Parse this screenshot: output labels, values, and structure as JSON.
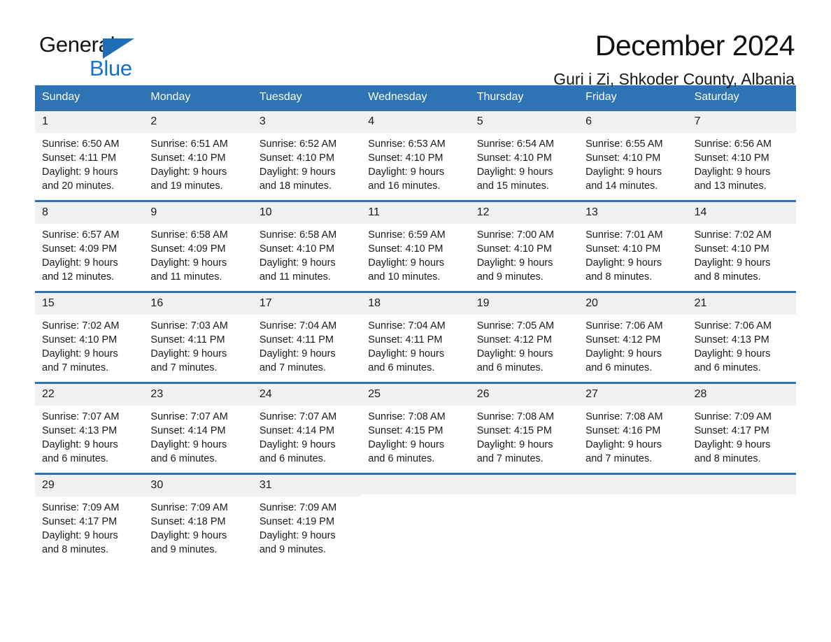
{
  "brand": {
    "name_dark": "General",
    "name_blue": "Blue",
    "accent_color": "#1771c4",
    "triangle_color": "#1f6eb5"
  },
  "header": {
    "title": "December 2024",
    "subtitle": "Guri i Zi, Shkoder County, Albania"
  },
  "table": {
    "header_bg": "#2e74b5",
    "header_text_color": "#ffffff",
    "daynum_bg": "#f1f1f1",
    "weekday_headers": [
      "Sunday",
      "Monday",
      "Tuesday",
      "Wednesday",
      "Thursday",
      "Friday",
      "Saturday"
    ]
  },
  "weeks": [
    [
      {
        "day": "1",
        "lines": [
          "Sunrise: 6:50 AM",
          "Sunset: 4:11 PM",
          "Daylight: 9 hours",
          "and 20 minutes."
        ]
      },
      {
        "day": "2",
        "lines": [
          "Sunrise: 6:51 AM",
          "Sunset: 4:10 PM",
          "Daylight: 9 hours",
          "and 19 minutes."
        ]
      },
      {
        "day": "3",
        "lines": [
          "Sunrise: 6:52 AM",
          "Sunset: 4:10 PM",
          "Daylight: 9 hours",
          "and 18 minutes."
        ]
      },
      {
        "day": "4",
        "lines": [
          "Sunrise: 6:53 AM",
          "Sunset: 4:10 PM",
          "Daylight: 9 hours",
          "and 16 minutes."
        ]
      },
      {
        "day": "5",
        "lines": [
          "Sunrise: 6:54 AM",
          "Sunset: 4:10 PM",
          "Daylight: 9 hours",
          "and 15 minutes."
        ]
      },
      {
        "day": "6",
        "lines": [
          "Sunrise: 6:55 AM",
          "Sunset: 4:10 PM",
          "Daylight: 9 hours",
          "and 14 minutes."
        ]
      },
      {
        "day": "7",
        "lines": [
          "Sunrise: 6:56 AM",
          "Sunset: 4:10 PM",
          "Daylight: 9 hours",
          "and 13 minutes."
        ]
      }
    ],
    [
      {
        "day": "8",
        "lines": [
          "Sunrise: 6:57 AM",
          "Sunset: 4:09 PM",
          "Daylight: 9 hours",
          "and 12 minutes."
        ]
      },
      {
        "day": "9",
        "lines": [
          "Sunrise: 6:58 AM",
          "Sunset: 4:09 PM",
          "Daylight: 9 hours",
          "and 11 minutes."
        ]
      },
      {
        "day": "10",
        "lines": [
          "Sunrise: 6:58 AM",
          "Sunset: 4:10 PM",
          "Daylight: 9 hours",
          "and 11 minutes."
        ]
      },
      {
        "day": "11",
        "lines": [
          "Sunrise: 6:59 AM",
          "Sunset: 4:10 PM",
          "Daylight: 9 hours",
          "and 10 minutes."
        ]
      },
      {
        "day": "12",
        "lines": [
          "Sunrise: 7:00 AM",
          "Sunset: 4:10 PM",
          "Daylight: 9 hours",
          "and 9 minutes."
        ]
      },
      {
        "day": "13",
        "lines": [
          "Sunrise: 7:01 AM",
          "Sunset: 4:10 PM",
          "Daylight: 9 hours",
          "and 8 minutes."
        ]
      },
      {
        "day": "14",
        "lines": [
          "Sunrise: 7:02 AM",
          "Sunset: 4:10 PM",
          "Daylight: 9 hours",
          "and 8 minutes."
        ]
      }
    ],
    [
      {
        "day": "15",
        "lines": [
          "Sunrise: 7:02 AM",
          "Sunset: 4:10 PM",
          "Daylight: 9 hours",
          "and 7 minutes."
        ]
      },
      {
        "day": "16",
        "lines": [
          "Sunrise: 7:03 AM",
          "Sunset: 4:11 PM",
          "Daylight: 9 hours",
          "and 7 minutes."
        ]
      },
      {
        "day": "17",
        "lines": [
          "Sunrise: 7:04 AM",
          "Sunset: 4:11 PM",
          "Daylight: 9 hours",
          "and 7 minutes."
        ]
      },
      {
        "day": "18",
        "lines": [
          "Sunrise: 7:04 AM",
          "Sunset: 4:11 PM",
          "Daylight: 9 hours",
          "and 6 minutes."
        ]
      },
      {
        "day": "19",
        "lines": [
          "Sunrise: 7:05 AM",
          "Sunset: 4:12 PM",
          "Daylight: 9 hours",
          "and 6 minutes."
        ]
      },
      {
        "day": "20",
        "lines": [
          "Sunrise: 7:06 AM",
          "Sunset: 4:12 PM",
          "Daylight: 9 hours",
          "and 6 minutes."
        ]
      },
      {
        "day": "21",
        "lines": [
          "Sunrise: 7:06 AM",
          "Sunset: 4:13 PM",
          "Daylight: 9 hours",
          "and 6 minutes."
        ]
      }
    ],
    [
      {
        "day": "22",
        "lines": [
          "Sunrise: 7:07 AM",
          "Sunset: 4:13 PM",
          "Daylight: 9 hours",
          "and 6 minutes."
        ]
      },
      {
        "day": "23",
        "lines": [
          "Sunrise: 7:07 AM",
          "Sunset: 4:14 PM",
          "Daylight: 9 hours",
          "and 6 minutes."
        ]
      },
      {
        "day": "24",
        "lines": [
          "Sunrise: 7:07 AM",
          "Sunset: 4:14 PM",
          "Daylight: 9 hours",
          "and 6 minutes."
        ]
      },
      {
        "day": "25",
        "lines": [
          "Sunrise: 7:08 AM",
          "Sunset: 4:15 PM",
          "Daylight: 9 hours",
          "and 6 minutes."
        ]
      },
      {
        "day": "26",
        "lines": [
          "Sunrise: 7:08 AM",
          "Sunset: 4:15 PM",
          "Daylight: 9 hours",
          "and 7 minutes."
        ]
      },
      {
        "day": "27",
        "lines": [
          "Sunrise: 7:08 AM",
          "Sunset: 4:16 PM",
          "Daylight: 9 hours",
          "and 7 minutes."
        ]
      },
      {
        "day": "28",
        "lines": [
          "Sunrise: 7:09 AM",
          "Sunset: 4:17 PM",
          "Daylight: 9 hours",
          "and 8 minutes."
        ]
      }
    ],
    [
      {
        "day": "29",
        "lines": [
          "Sunrise: 7:09 AM",
          "Sunset: 4:17 PM",
          "Daylight: 9 hours",
          "and 8 minutes."
        ]
      },
      {
        "day": "30",
        "lines": [
          "Sunrise: 7:09 AM",
          "Sunset: 4:18 PM",
          "Daylight: 9 hours",
          "and 9 minutes."
        ]
      },
      {
        "day": "31",
        "lines": [
          "Sunrise: 7:09 AM",
          "Sunset: 4:19 PM",
          "Daylight: 9 hours",
          "and 9 minutes."
        ]
      },
      {
        "day": "",
        "lines": []
      },
      {
        "day": "",
        "lines": []
      },
      {
        "day": "",
        "lines": []
      },
      {
        "day": "",
        "lines": []
      }
    ]
  ]
}
